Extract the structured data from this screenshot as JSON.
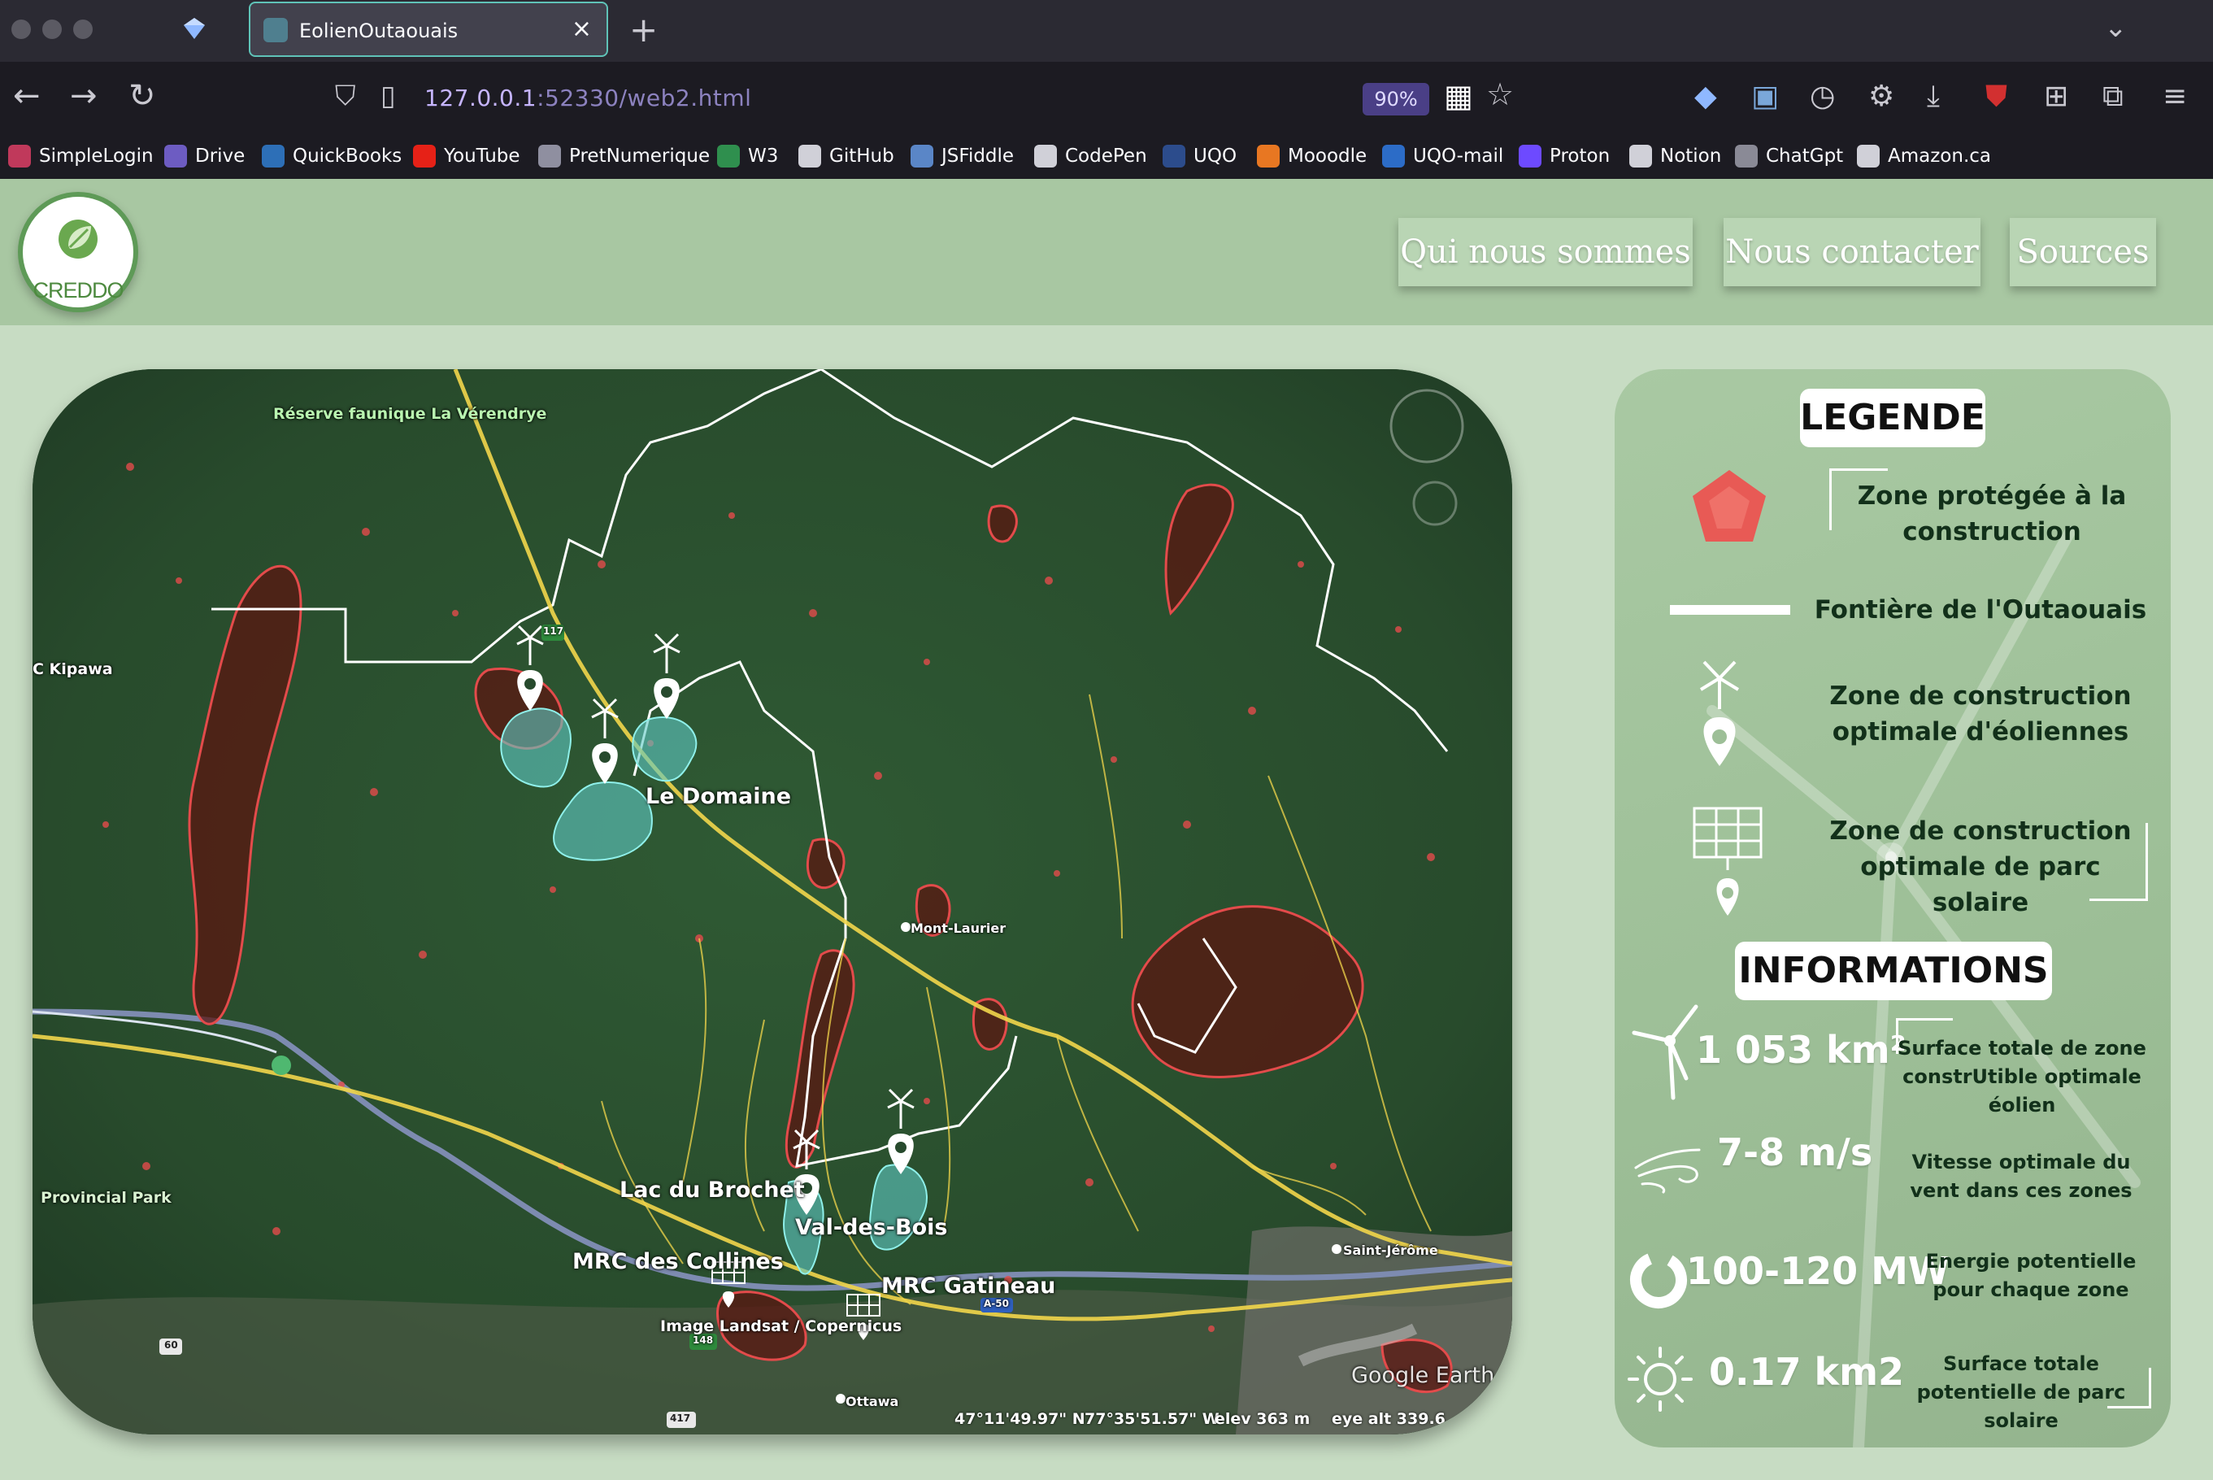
{
  "browser": {
    "tab_title": "EolienOutaouais",
    "url_host": "127.0.0.1",
    "url_rest": ":52330/web2.html",
    "zoom": "90%",
    "bookmarks": [
      {
        "label": "SimpleLogin",
        "color": "#c0395b"
      },
      {
        "label": "Drive",
        "color": "#6d5cc2"
      },
      {
        "label": "QuickBooks",
        "color": "#2d6fb7"
      },
      {
        "label": "YouTube",
        "color": "#e62117"
      },
      {
        "label": "PretNumerique",
        "color": "#8f8fa0"
      },
      {
        "label": "W3",
        "color": "#2f8f4e"
      },
      {
        "label": "GitHub",
        "color": "#d0d0d8"
      },
      {
        "label": "JSFiddle",
        "color": "#5a86c7"
      },
      {
        "label": "CodePen",
        "color": "#d0d0d8"
      },
      {
        "label": "UQO",
        "color": "#2c4c8c"
      },
      {
        "label": "Mooodle",
        "color": "#e87722"
      },
      {
        "label": "UQO-mail",
        "color": "#2c6cc7"
      },
      {
        "label": "Proton",
        "color": "#6d4aff"
      },
      {
        "label": "Notion",
        "color": "#d0d0d8"
      },
      {
        "label": "ChatGpt",
        "color": "#8a8a96"
      },
      {
        "label": "Amazon.ca",
        "color": "#d0d0d8"
      }
    ]
  },
  "site": {
    "brand": "CREDDO",
    "nav": [
      "Qui nous sommes",
      "Nous contacter",
      "Sources"
    ]
  },
  "map": {
    "labels": {
      "reserve": "Réserve faunique La Vérendrye",
      "kipawa": "C Kipawa",
      "provincial_park": "Provincial Park",
      "le_domaine": "Le Domaine",
      "mont_laurier": "Mont-Laurier",
      "lac_du_brochet": "Lac du Brochet",
      "val_des_bois": "Val-des-Bois",
      "mrc_collines": "MRC des Collines",
      "mrc_gatineau": "MRC Gatineau",
      "saint_jerome": "Saint-Jérôme",
      "ottawa": "Ottawa",
      "attribution": "Image Landsat / Copernicus",
      "google_earth": "Google Earth",
      "route_117": "117",
      "route_148": "148",
      "route_60": "60",
      "route_417": "417",
      "route_a50": "A-50"
    },
    "coords": {
      "lat": "47°11'49.97\" N",
      "lon": "77°35'51.57\" W",
      "elev": "elev  363 m",
      "eye": "eye alt 339.6"
    }
  },
  "legend": {
    "title": "LEGENDE",
    "items": [
      {
        "icon": "pentagon-icon",
        "text": "Zone protégée à la construction"
      },
      {
        "icon": "border-line-icon",
        "text": "Fontière de l'Outaouais"
      },
      {
        "icon": "wind-turbine-pin-icon",
        "text": "Zone de construction optimale d'éoliennes"
      },
      {
        "icon": "solar-panel-pin-icon",
        "text": "Zone de construction optimale de parc solaire"
      }
    ]
  },
  "informations": {
    "title": "INFORMATIONS",
    "items": [
      {
        "icon": "wind-turbine-icon",
        "value": "1 053 km²",
        "desc": "Surface totale de zone constrUtible optimale éolien"
      },
      {
        "icon": "wind-icon",
        "value": "7-8 m/s",
        "desc": "Vitesse optimale du vent dans ces zones"
      },
      {
        "icon": "power-ring-icon",
        "value": "100-120 MW",
        "desc": "Energie potentielle pour chaque zone"
      },
      {
        "icon": "sun-icon",
        "value": "0.17 km2",
        "desc": "Surface totale potentielle de parc solaire"
      }
    ]
  },
  "colors": {
    "header_bg": "#a8c7a2",
    "page_bg": "#c7dcc3",
    "protected_zone": "#e34b4b",
    "optimal_zone": "#5fc9c4",
    "road": "#f2d64b"
  }
}
